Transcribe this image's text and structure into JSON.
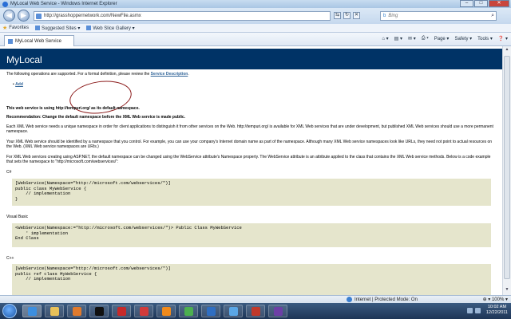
{
  "window": {
    "title": "MyLocal Web Service - Windows Internet Explorer",
    "min": "–",
    "max": "□",
    "close": "✕"
  },
  "nav": {
    "back_icon": "◀",
    "forward_icon": "▶",
    "url": "http://grasshoppernetwork.com/NewFile.asmx",
    "compat_icon": "⇆",
    "refresh_icon": "↻",
    "stop_icon": "✕",
    "search_provider": "b",
    "search_placeholder": "Bing",
    "search_icon": "⌕"
  },
  "favorites": {
    "label": "Favorites",
    "items": [
      "Suggested Sites ▾",
      "Web Slice Gallery ▾"
    ]
  },
  "tab": {
    "label": "MyLocal Web Service"
  },
  "commands": [
    "⌂ ▾",
    "▤ ▾",
    "✉ ▾",
    "⎙ ▾",
    "Page ▾",
    "Safety ▾",
    "Tools ▾",
    "❓ ▾"
  ],
  "page": {
    "service_name": "MyLocal",
    "intro_prefix": "The following operations are supported.  For a formal definition, please review the ",
    "intro_link": "Service Description",
    "intro_suffix": ".",
    "operation_bullet": "•",
    "operation": "Add",
    "ns_prefix": "This web service is using ",
    "ns_value": "http://tempuri.org/",
    "ns_suffix": " as its default namespace.",
    "recommendation": "Recommendation: Change the default namespace before the XML Web service is made public.",
    "para1": "Each XML Web service needs a unique namespace in order for client applications to distinguish it from other services on the Web. http://tempuri.org/ is available for XML Web services that are under development, but published XML Web services should use a more permanent namespace.",
    "para2": "Your XML Web service should be identified by a namespace that you control. For example, you can use your company's Internet domain name as part of the namespace. Although many XML Web service namespaces look like URLs, they need not point to actual resources on the Web. (XML Web service namespaces are URIs.)",
    "para3": "For XML Web services creating using ASP.NET, the default namespace can be changed using the WebService attribute's Namespace property. The WebService attribute is an attribute applied to the class that contains the XML Web service methods. Below is a code example that sets the namespace to \"http://microsoft.com/webservices/\":",
    "lang_cs": "C#",
    "code_cs": "[WebService(Namespace=\"http://microsoft.com/webservices/\")]\npublic class MyWebService {\n    // implementation\n}",
    "lang_vb": "Visual Basic",
    "code_vb": "<WebService(Namespace:=\"http://microsoft.com/webservices/\")> Public Class MyWebService\n    ' implementation\nEnd Class",
    "lang_cpp": "C++",
    "code_cpp": "[WebService(Namespace=\"http://microsoft.com/webservices/\")]\npublic ref class MyWebService {\n    // implementation"
  },
  "status": {
    "zone": "Internet | Protected Mode: On",
    "zoom": "⊕ ▾ 100% ▾"
  },
  "taskbar": {
    "apps": [
      {
        "name": "ie",
        "color": "#3d8fe0"
      },
      {
        "name": "explorer",
        "color": "#e8c15a"
      },
      {
        "name": "media",
        "color": "#e07a2d"
      },
      {
        "name": "cmd",
        "color": "#111111"
      },
      {
        "name": "acrobat",
        "color": "#c62a2a"
      },
      {
        "name": "acrobat2",
        "color": "#d13b3b"
      },
      {
        "name": "vlc",
        "color": "#f08a1c"
      },
      {
        "name": "chrome",
        "color": "#4caf50"
      },
      {
        "name": "editor",
        "color": "#2f6ec2"
      },
      {
        "name": "paint",
        "color": "#5aa6e6"
      },
      {
        "name": "filezilla",
        "color": "#c0392b"
      },
      {
        "name": "visual-studio",
        "color": "#6c3fa6"
      }
    ],
    "time": "10:02 AM",
    "date": "12/22/2011"
  }
}
